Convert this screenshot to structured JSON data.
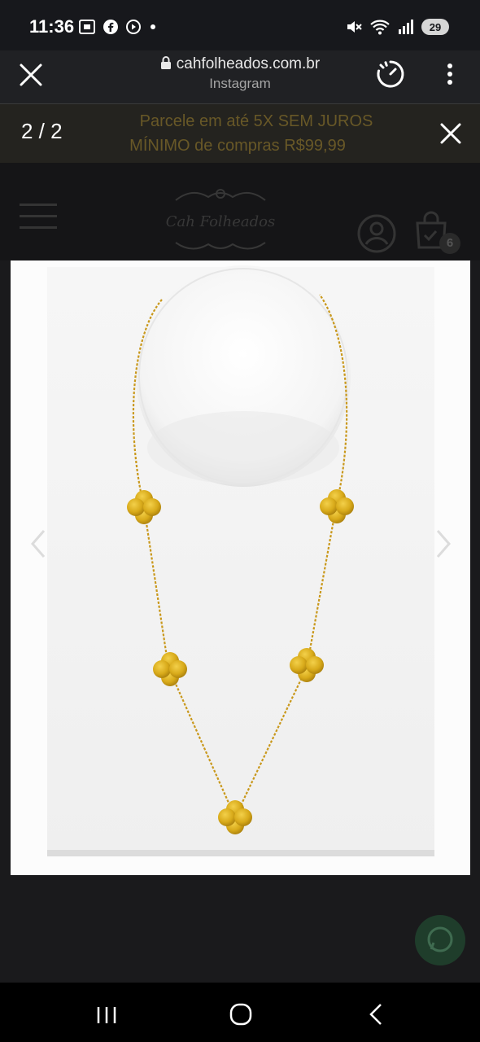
{
  "status_bar": {
    "time": "11:36",
    "battery": "29",
    "left_icons": [
      "screenshot-icon",
      "facebook-icon",
      "media-icon",
      "dot-icon"
    ],
    "right_icons": [
      "mute-icon",
      "wifi-icon",
      "signal-icon"
    ]
  },
  "browser": {
    "url": "cahfolheados.com.br",
    "subtitle": "Instagram",
    "icons": [
      "close-icon",
      "speed-icon",
      "more-icon"
    ]
  },
  "site": {
    "promo_line1": "Parcele em até 5X SEM JUROS",
    "promo_line2": "MÍNIMO de compras R$99,99",
    "cart_count": "6",
    "logo_text": "Cah Folheados"
  },
  "gallery": {
    "counter": "2 / 2",
    "image_alt": "gold clover necklace on white display"
  },
  "colors": {
    "gold": "#d8aa1a",
    "promo_text": "#a88e40",
    "whatsapp": "#1f3d2b"
  }
}
